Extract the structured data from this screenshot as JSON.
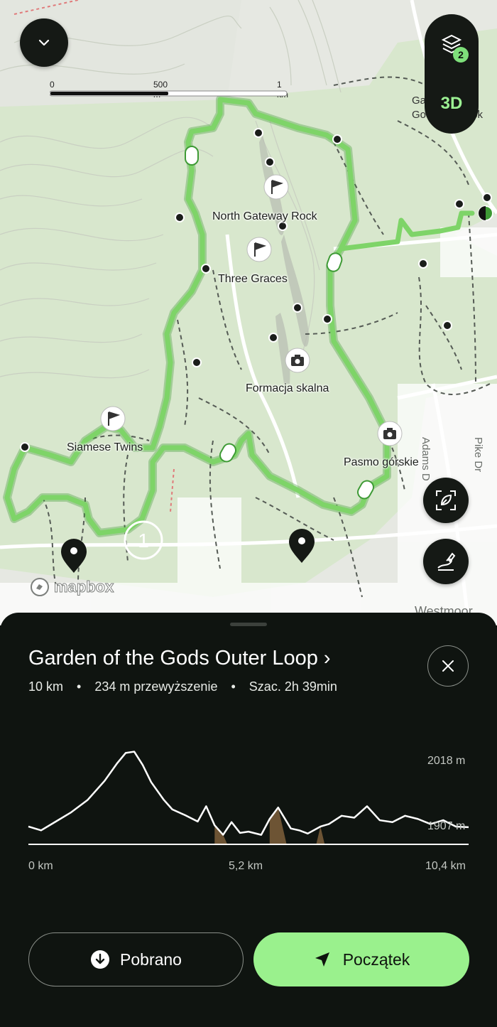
{
  "map": {
    "scale": {
      "labels": [
        "0",
        "500 m",
        "1 km"
      ]
    },
    "layers_count": "2",
    "mode_label": "3D",
    "attribution": "mapbox",
    "pois": [
      {
        "label": "North Gateway Rock",
        "icon": "flag-icon"
      },
      {
        "label": "Three Graces",
        "icon": "flag-icon"
      },
      {
        "label": "Formacja skalna",
        "icon": "camera-icon"
      },
      {
        "label": "Pasmo górskie",
        "icon": "camera-icon"
      },
      {
        "label": "Siamese Twins",
        "icon": "flag-icon"
      }
    ],
    "road_labels": [
      "Adams D",
      "Pike Dr",
      "Westmoor",
      "Garden of the Gods Overlook"
    ]
  },
  "route": {
    "title": "Garden of the Gods Outer Loop ›",
    "distance": "10 km",
    "elevation_gain": "234 m przewyższenie",
    "estimate": "Szac. 2h 39min",
    "separator": "•"
  },
  "chart_data": {
    "type": "area",
    "xlabel": "",
    "ylabel": "",
    "x_ticks": [
      "0 km",
      "5,2 km",
      "10,4 km"
    ],
    "y_ticks": [
      "2018 m",
      "1907 m"
    ],
    "ylim": [
      1880,
      2030
    ],
    "xlim": [
      0,
      10.4
    ],
    "series": [
      {
        "x": [
          0,
          0.3,
          0.6,
          1.0,
          1.4,
          1.8,
          2.1,
          2.3,
          2.5,
          2.7,
          2.9,
          3.2,
          3.4,
          3.7,
          4.0,
          4.2,
          4.4,
          4.6,
          4.8,
          5.0,
          5.2,
          5.5,
          5.7,
          5.9,
          6.2,
          6.4,
          6.6,
          6.9,
          7.1,
          7.4,
          7.7,
          8.0,
          8.3,
          8.6,
          8.9,
          9.2,
          9.5,
          9.8,
          10.1,
          10.4
        ],
        "y": [
          1908,
          1902,
          1914,
          1930,
          1950,
          1980,
          2008,
          2024,
          2026,
          2005,
          1978,
          1950,
          1935,
          1926,
          1916,
          1940,
          1910,
          1895,
          1915,
          1898,
          1900,
          1895,
          1920,
          1938,
          1905,
          1902,
          1897,
          1908,
          1912,
          1925,
          1922,
          1940,
          1918,
          1915,
          1925,
          1920,
          1912,
          1918,
          1908,
          1907
        ]
      }
    ],
    "steep_ranges_km": [
      [
        4.4,
        4.7
      ],
      [
        5.7,
        6.1
      ],
      [
        6.8,
        7.0
      ]
    ]
  },
  "buttons": {
    "download_label": "Pobrano",
    "start_label": "Początek"
  },
  "colors": {
    "route": "#7ed468",
    "route_dark": "#3e9a35",
    "sheet_bg": "#0f1410",
    "accent": "#9af18d",
    "steep": "#6d5434"
  }
}
